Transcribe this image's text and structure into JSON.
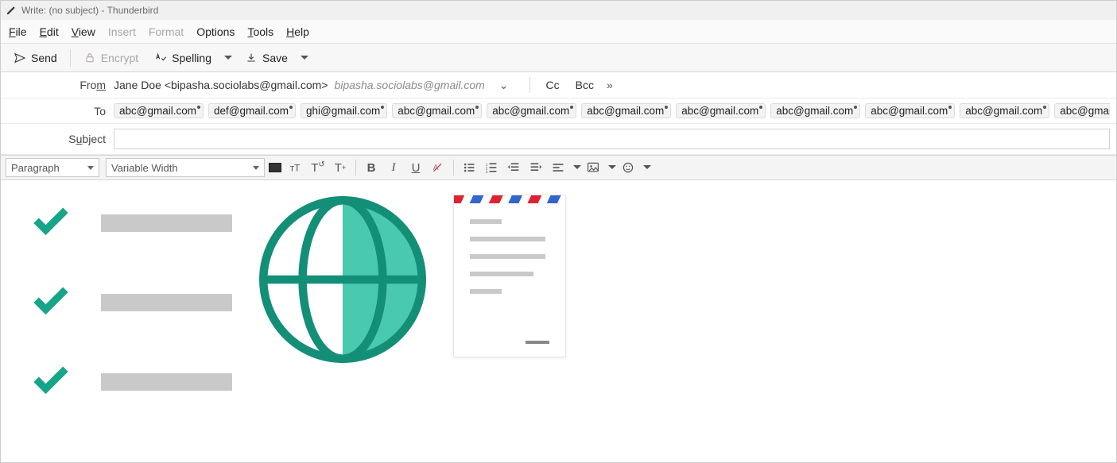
{
  "window": {
    "title": "Write: (no subject) - Thunderbird"
  },
  "menubar": {
    "file": "File",
    "edit": "Edit",
    "view": "View",
    "insert": "Insert",
    "format": "Format",
    "options": "Options",
    "tools": "Tools",
    "help": "Help"
  },
  "toolbar": {
    "send": "Send",
    "encrypt": "Encrypt",
    "spelling": "Spelling",
    "save": "Save"
  },
  "from": {
    "label": "From",
    "identity": "Jane Doe <bipasha.sociolabs@gmail.com>",
    "account": "bipasha.sociolabs@gmail.com",
    "cc": "Cc",
    "bcc": "Bcc"
  },
  "to": {
    "label": "To",
    "chips": [
      "abc@gmail.com",
      "def@gmail.com",
      "ghi@gmail.com",
      "abc@gmail.com",
      "abc@gmail.com",
      "abc@gmail.com",
      "abc@gmail.com",
      "abc@gmail.com",
      "abc@gmail.com",
      "abc@gmail.com",
      "abc@gmail.com"
    ]
  },
  "subject": {
    "label": "Subject",
    "value": ""
  },
  "format": {
    "para_style": "Paragraph",
    "font_family": "Variable Width",
    "bold": "B",
    "italic": "I",
    "underline": "U"
  }
}
